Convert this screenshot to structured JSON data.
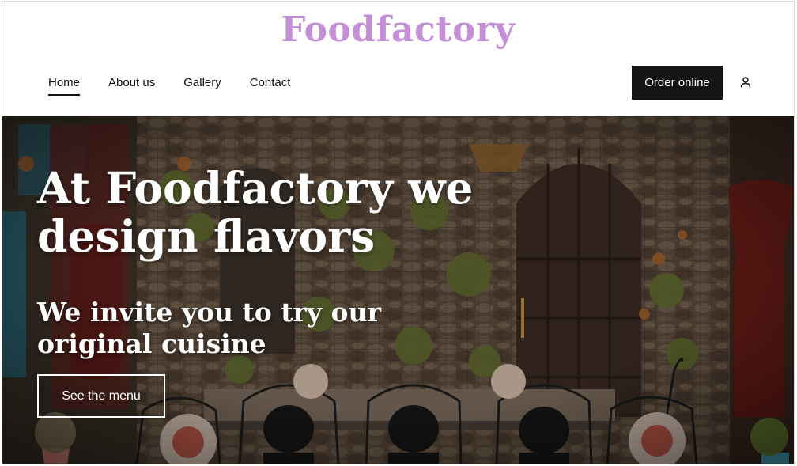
{
  "brand": {
    "name": "Foodfactory",
    "color": "#c48fd6"
  },
  "nav": {
    "items": [
      {
        "label": "Home",
        "active": true
      },
      {
        "label": "About us",
        "active": false
      },
      {
        "label": "Gallery",
        "active": false
      },
      {
        "label": "Contact",
        "active": false
      }
    ]
  },
  "header": {
    "order_label": "Order online",
    "user_icon": "user-icon"
  },
  "hero": {
    "title": "At Foodfactory we design flavors",
    "subtitle": "We invite you to try our original cuisine",
    "cta_label": "See the menu"
  },
  "colors": {
    "button_dark": "#141414",
    "text": "#111111"
  }
}
